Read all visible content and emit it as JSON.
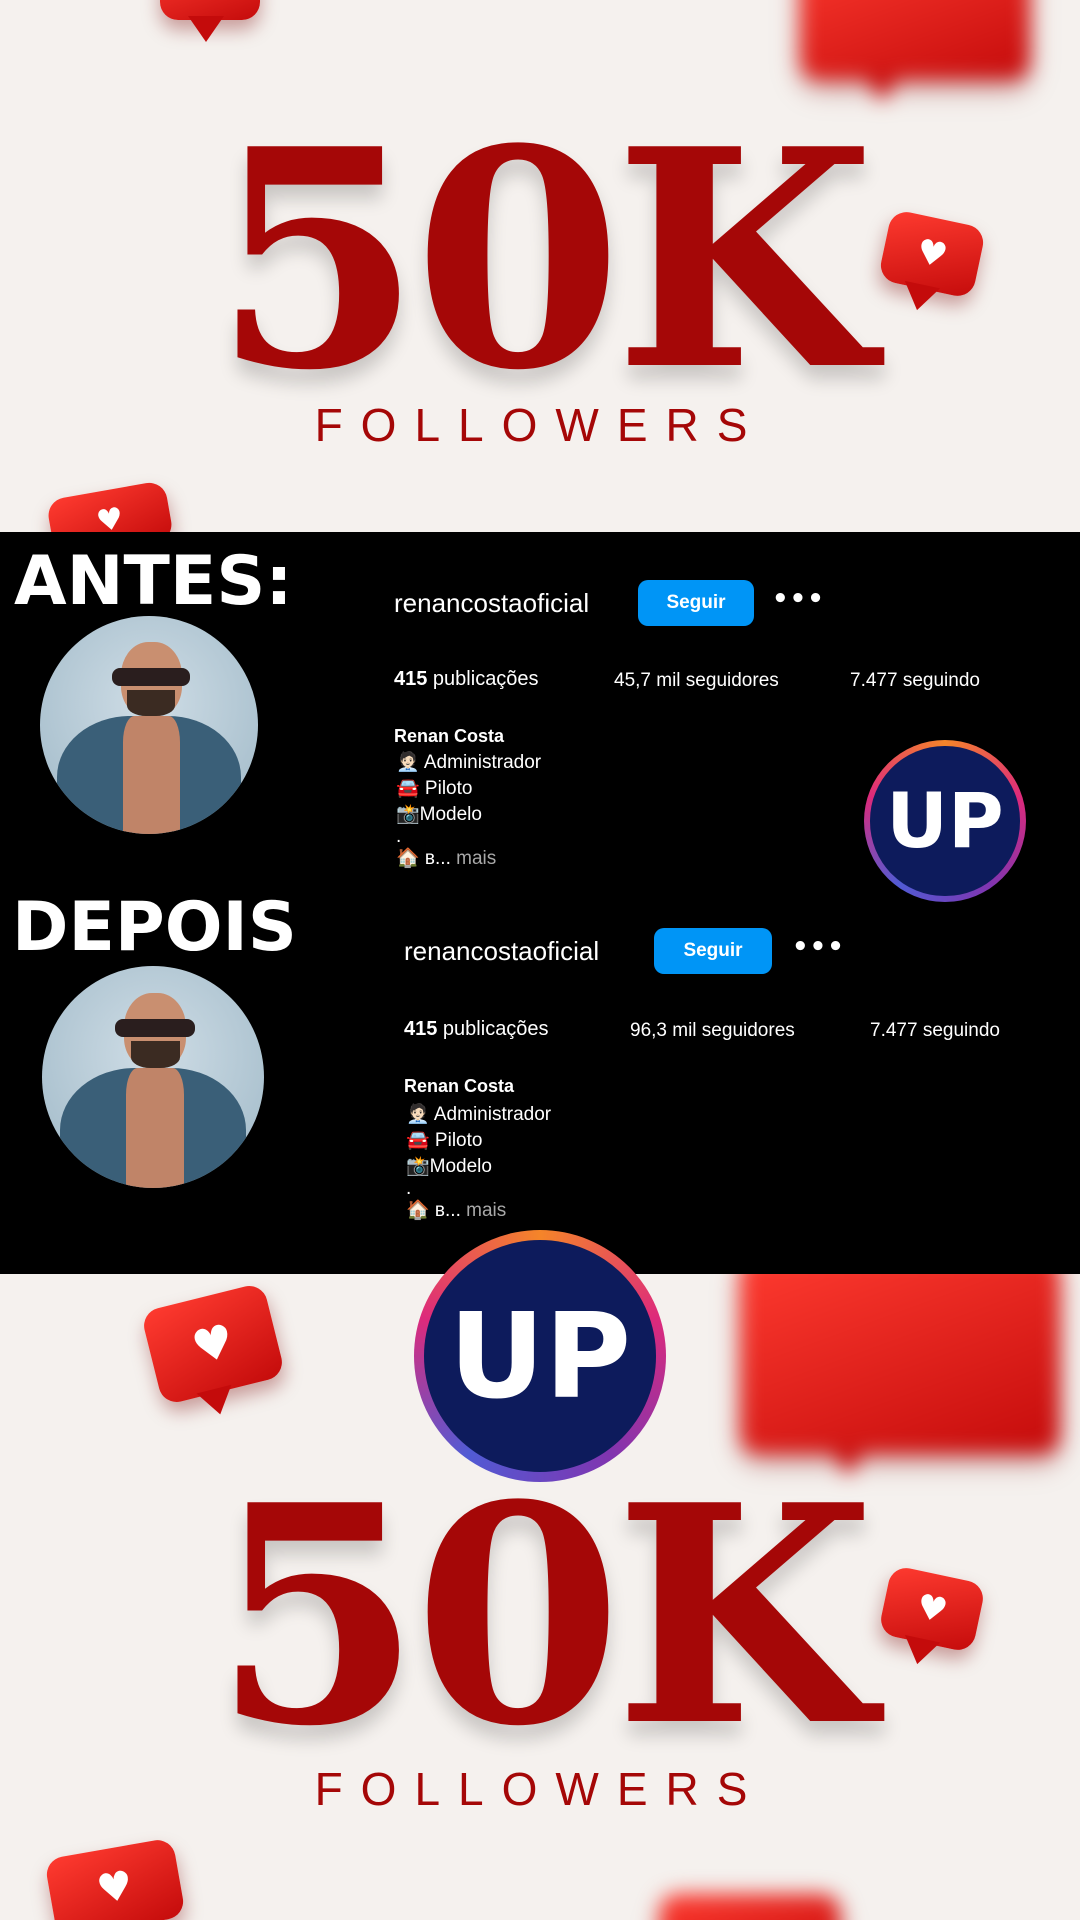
{
  "hero": {
    "big": "50K",
    "sub": "FOLLOWERS"
  },
  "before": {
    "label": "ANTES:",
    "username": "renancostaoficial",
    "follow": "Seguir",
    "more_icon": "ellipsis-icon",
    "posts_count": "415",
    "posts_label": " publicações",
    "followers": "45,7 mil seguidores",
    "following": "7.477 seguindo",
    "name": "Renan Costa",
    "bio": [
      "🧑🏻‍💼 Administrador",
      "🚘 Piloto",
      "📸Modelo",
      "."
    ],
    "bio_last": "🏠 ʙ...",
    "bio_more": " mais"
  },
  "after": {
    "label": "DEPOIS",
    "username": "renancostaoficial",
    "follow": "Seguir",
    "more_icon": "ellipsis-icon",
    "posts_count": "415",
    "posts_label": " publicações",
    "followers": "96,3 mil seguidores",
    "following": "7.477 seguindo",
    "name": "Renan Costa",
    "bio": [
      "🧑🏻‍💼 Administrador",
      "🚘 Piloto",
      "📸Modelo",
      "."
    ],
    "bio_last": "🏠 ʙ...",
    "bio_more": " mais"
  },
  "logo": {
    "text": "UP"
  },
  "colors": {
    "brand_red": "#a50707",
    "follow_blue": "#0095f6",
    "logo_navy": "#0d1b5c"
  }
}
